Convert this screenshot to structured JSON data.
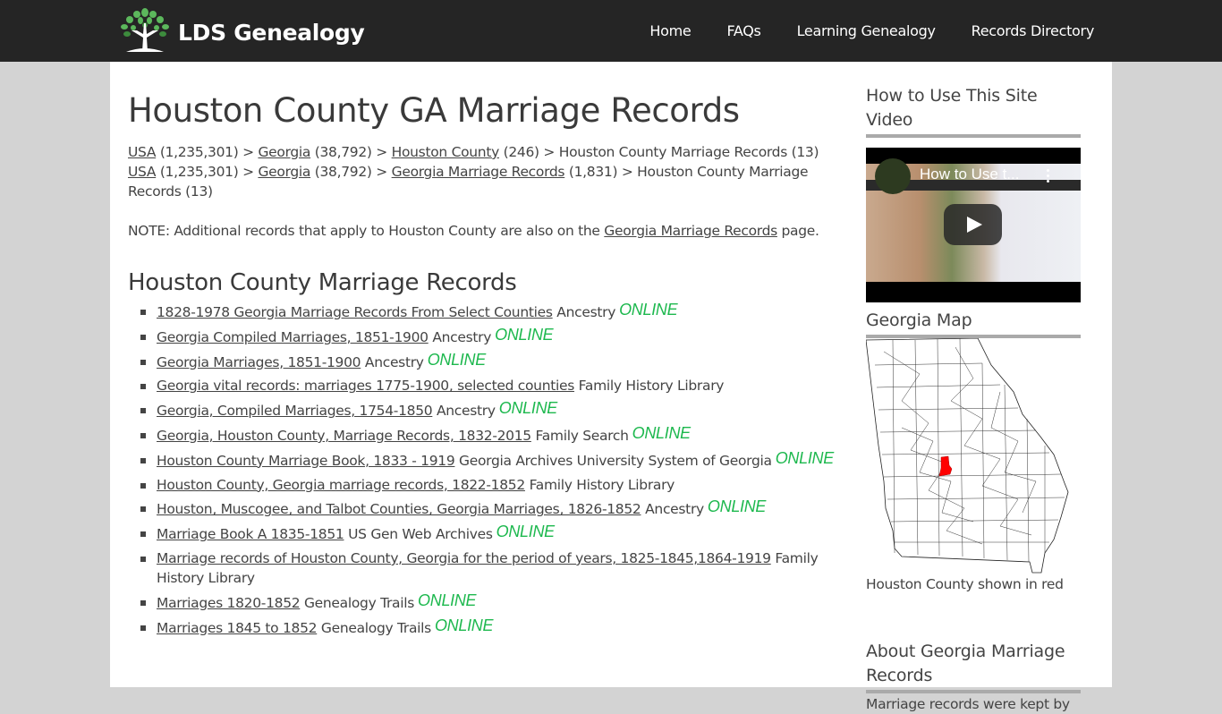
{
  "site": {
    "logo_text": "LDS Genealogy"
  },
  "nav": [
    {
      "label": "Home"
    },
    {
      "label": "FAQs"
    },
    {
      "label": "Learning Genealogy"
    },
    {
      "label": "Records Directory"
    }
  ],
  "main": {
    "title": "Houston County GA Marriage Records",
    "breadcrumbs": [
      {
        "parts": [
          {
            "link": "USA",
            "count": " (1,235,301) > "
          },
          {
            "link": "Georgia",
            "count": " (38,792) > "
          },
          {
            "link": "Houston County",
            "count": " (246) > "
          }
        ],
        "tail": "Houston County Marriage Records (13)"
      },
      {
        "parts": [
          {
            "link": "USA",
            "count": " (1,235,301) > "
          },
          {
            "link": "Georgia",
            "count": " (38,792) > "
          },
          {
            "link": "Georgia Marriage Records",
            "count": " (1,831) > "
          }
        ],
        "tail": "Houston County Marriage Records (13)"
      }
    ],
    "note": {
      "prefix": "NOTE: Additional records that apply to Houston County are also on the ",
      "link": "Georgia Marriage Records",
      "suffix": " page."
    },
    "section_title": "Houston County Marriage Records",
    "online_label": "ONLINE",
    "records": [
      {
        "title": "1828-1978 Georgia Marriage Records From Select Counties",
        "source": "Ancestry",
        "online": true
      },
      {
        "title": "Georgia Compiled Marriages, 1851-1900",
        "source": "Ancestry",
        "online": true
      },
      {
        "title": "Georgia Marriages, 1851-1900",
        "source": "Ancestry",
        "online": true
      },
      {
        "title": "Georgia vital records: marriages 1775-1900, selected counties",
        "source": "Family History Library",
        "online": false
      },
      {
        "title": "Georgia, Compiled Marriages, 1754-1850",
        "source": "Ancestry",
        "online": true
      },
      {
        "title": "Georgia, Houston County, Marriage Records, 1832-2015",
        "source": "Family Search",
        "online": true
      },
      {
        "title": "Houston County Marriage Book, 1833 - 1919",
        "source": "Georgia Archives University System of Georgia",
        "online": true
      },
      {
        "title": "Houston County, Georgia marriage records, 1822-1852",
        "source": "Family History Library",
        "online": false
      },
      {
        "title": "Houston, Muscogee, and Talbot Counties, Georgia Marriages, 1826-1852",
        "source": "Ancestry",
        "online": true
      },
      {
        "title": "Marriage Book A 1835-1851",
        "source": "US Gen Web Archives",
        "online": true
      },
      {
        "title": "Marriage records of Houston County, Georgia for the period of years, 1825-1845,1864-1919",
        "source": "Family History Library",
        "online": false
      },
      {
        "title": "Marriages 1820-1852",
        "source": "Genealogy Trails",
        "online": true
      },
      {
        "title": "Marriages 1845 to 1852",
        "source": "Genealogy Trails",
        "online": true
      }
    ]
  },
  "sidebar": {
    "video_title": "How to Use This Site Video",
    "video_overlay_title": "How to Use t...",
    "map_title": "Georgia Map",
    "map_caption": "Houston County shown in red",
    "highlight_color": "#ff0000",
    "about_title": "About Georgia Marriage Records",
    "about_text": "Marriage records were kept by"
  },
  "colors": {
    "header_bg": "#252525",
    "page_bg": "#d3d3d3",
    "online_green": "#1db84e",
    "text": "#444444"
  }
}
